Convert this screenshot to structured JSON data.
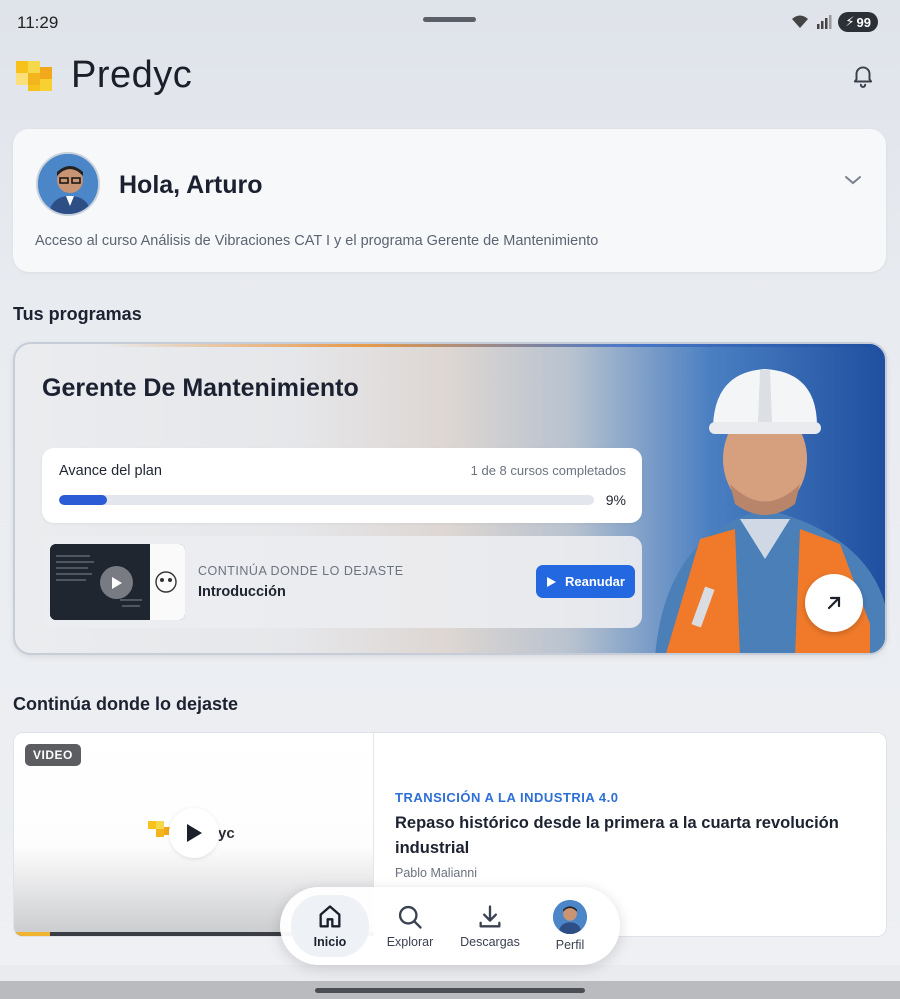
{
  "status": {
    "time": "11:29",
    "battery": "99"
  },
  "header": {
    "logo_text": "Predyc"
  },
  "greeting": {
    "title": "Hola, Arturo",
    "subtitle": "Acceso al curso Análisis de Vibraciones CAT I y el programa Gerente de Mantenimiento"
  },
  "programs": {
    "section_title": "Tus programas",
    "card": {
      "title": "Gerente De Mantenimiento",
      "progress_label": "Avance del plan",
      "progress_count": "1 de 8 cursos completados",
      "progress_percent_text": "9%",
      "progress_fraction": 0.09,
      "resume_eyebrow": "CONTINÚA DONDE LO DEJASTE",
      "resume_lesson": "Introducción",
      "resume_button": "Reanudar"
    }
  },
  "continue": {
    "section_title": "Continúa donde lo dejaste",
    "badge": "VIDEO",
    "video_logo_text": "yc",
    "watched_fraction": 0.1,
    "eyebrow": "TRANSICIÓN A LA INDUSTRIA 4.0",
    "title": "Repaso histórico desde la primera a la cuarta revolución industrial",
    "author": "Pablo Malianni"
  },
  "nav": {
    "items": [
      {
        "label": "Inicio",
        "icon": "home-icon"
      },
      {
        "label": "Explorar",
        "icon": "search-icon"
      },
      {
        "label": "Descargas",
        "icon": "download-icon"
      },
      {
        "label": "Perfil",
        "icon": "avatar"
      }
    ]
  },
  "colors": {
    "accent": "#2368e0",
    "progress": "#2c5bd6",
    "eyebrow_blue": "#2d6fd6",
    "brand_yellow": "#f5c518"
  }
}
